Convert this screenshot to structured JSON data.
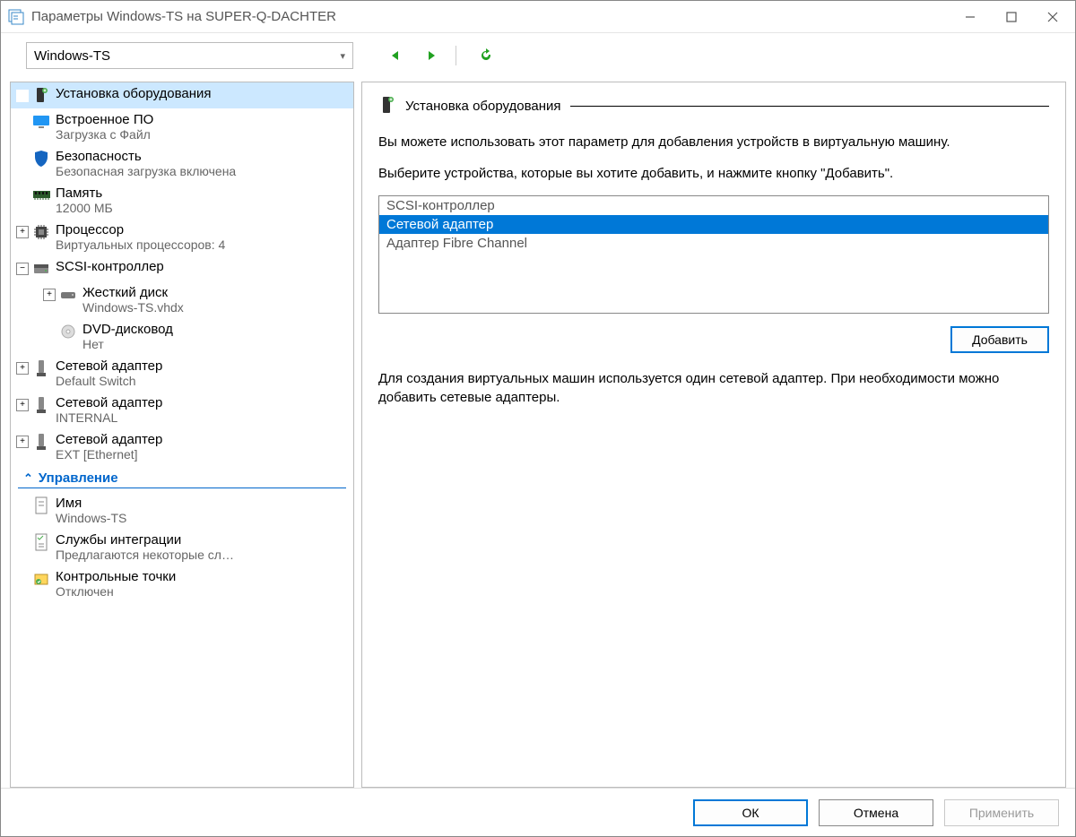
{
  "window": {
    "title": "Параметры Windows-TS на SUPER-Q-DACHTER"
  },
  "toolbar": {
    "vm_name": "Windows-TS"
  },
  "sidebar": {
    "items": [
      {
        "label": "Установка оборудования",
        "sub": "",
        "icon": "hardware",
        "exp": "",
        "indent": 0,
        "selected": true
      },
      {
        "label": "Встроенное ПО",
        "sub": "Загрузка с Файл",
        "icon": "monitor",
        "exp": "",
        "indent": 0
      },
      {
        "label": "Безопасность",
        "sub": "Безопасная загрузка включена",
        "icon": "shield",
        "exp": "",
        "indent": 0
      },
      {
        "label": "Память",
        "sub": "12000 МБ",
        "icon": "ram",
        "exp": "",
        "indent": 0
      },
      {
        "label": "Процессор",
        "sub": "Виртуальных процессоров: 4",
        "icon": "cpu",
        "exp": "+",
        "indent": 0
      },
      {
        "label": "SCSI-контроллер",
        "sub": "",
        "icon": "scsi",
        "exp": "−",
        "indent": 0
      },
      {
        "label": "Жесткий диск",
        "sub": "Windows-TS.vhdx",
        "icon": "hdd",
        "exp": "+",
        "indent": 1
      },
      {
        "label": "DVD-дисковод",
        "sub": "Нет",
        "icon": "dvd",
        "exp": "",
        "indent": 1
      },
      {
        "label": "Сетевой адаптер",
        "sub": "Default Switch",
        "icon": "nic",
        "exp": "+",
        "indent": 0
      },
      {
        "label": "Сетевой адаптер",
        "sub": "INTERNAL",
        "icon": "nic",
        "exp": "+",
        "indent": 0
      },
      {
        "label": "Сетевой адаптер",
        "sub": "EXT [Ethernet]",
        "icon": "nic",
        "exp": "+",
        "indent": 0
      }
    ],
    "management_header": "Управление",
    "management": [
      {
        "label": "Имя",
        "sub": "Windows-TS",
        "icon": "name"
      },
      {
        "label": "Службы интеграции",
        "sub": "Предлагаются некоторые сл…",
        "icon": "services"
      },
      {
        "label": "Контрольные точки",
        "sub": "Отключен",
        "icon": "checkpoint"
      }
    ]
  },
  "content": {
    "title": "Установка оборудования",
    "p1": "Вы можете использовать этот параметр для добавления устройств в виртуальную машину.",
    "p2": "Выберите устройства, которые вы хотите добавить, и нажмите кнопку \"Добавить\".",
    "devices": [
      {
        "label": "SCSI-контроллер",
        "selected": false
      },
      {
        "label": "Сетевой адаптер",
        "selected": true
      },
      {
        "label": "Адаптер Fibre Channel",
        "selected": false
      }
    ],
    "add_button": "Добавить",
    "p3": "Для создания виртуальных машин используется один сетевой адаптер. При необходимости можно добавить сетевые адаптеры."
  },
  "footer": {
    "ok": "ОК",
    "cancel": "Отмена",
    "apply": "Применить"
  }
}
